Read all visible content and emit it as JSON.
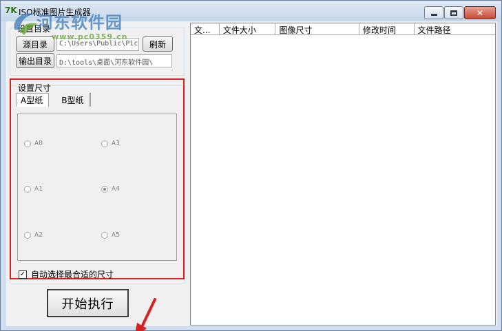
{
  "window": {
    "title": "ISO标准图片生成器",
    "app_icon_text": "7K"
  },
  "watermark": {
    "text": "河东软件园",
    "url": "www.pc0359.cn"
  },
  "directory_group": {
    "legend": "设置目录",
    "source_button": "源目录",
    "source_path": "C:\\Users\\Public\\Pic",
    "refresh_button": "刷新",
    "output_button": "输出目录",
    "output_path": "D:\\tools\\桌面\\河东软件园\\"
  },
  "size_group": {
    "legend": "设置尺寸",
    "tabs": [
      {
        "label": "A型纸",
        "active": true
      },
      {
        "label": "B型纸",
        "active": false
      }
    ],
    "options": [
      {
        "label": "A0",
        "checked": false
      },
      {
        "label": "A3",
        "checked": false
      },
      {
        "label": "A1",
        "checked": false
      },
      {
        "label": "A4",
        "checked": true
      },
      {
        "label": "A2",
        "checked": false
      },
      {
        "label": "A5",
        "checked": false
      }
    ],
    "auto_select_label": "自动选择最合适的尺寸",
    "auto_select_checked": true
  },
  "start_button": "开始执行",
  "list": {
    "columns": [
      "文...",
      "文件大小",
      "图像尺寸",
      "修改时间",
      "文件路径"
    ],
    "rows": []
  },
  "colors": {
    "highlight_border": "#d62021",
    "arrow": "#d62021"
  },
  "icons": {
    "minimize": "minimize-icon",
    "maximize": "maximize-icon",
    "close": "close-icon",
    "arrow": "annotation-arrow-icon"
  }
}
